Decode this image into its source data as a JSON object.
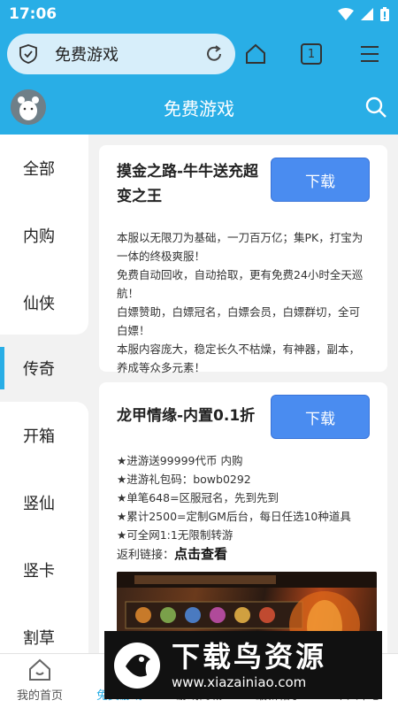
{
  "status": {
    "time": "17:06"
  },
  "browser": {
    "url_text": "免费游戏",
    "tab_count": "1"
  },
  "header": {
    "title": "免费游戏"
  },
  "sidebar": {
    "items": [
      {
        "label": "全部"
      },
      {
        "label": "内购"
      },
      {
        "label": "仙侠"
      },
      {
        "label": "传奇"
      },
      {
        "label": "开箱"
      },
      {
        "label": "竖仙"
      },
      {
        "label": "竖卡"
      },
      {
        "label": "割草"
      }
    ],
    "active_index": 3
  },
  "cards": [
    {
      "title": "摸金之路-牛牛送充超变之王",
      "download_label": "下载",
      "lines": [
        "本服以无限刀为基础，一刀百万亿；集PK，打宝为一体的终极爽服！",
        "免费自动回收，自动拾取，更有免费24小时全天巡航！",
        "白嫖赞助，白嫖冠名，白嫖会员，白嫖群切，全可白嫖！",
        "本服内容庞大，稳定长久不枯燥，有神器，副本，养成等众多元素！"
      ]
    },
    {
      "title": "龙甲情缘-内置0.1折",
      "download_label": "下载",
      "lines": [
        "★进游送99999代币 内购",
        "★进游礼包码：bowb0292",
        "★单笔648=区服冠名，先到先到",
        "★累计2500=定制GM后台，每日任选10种道具",
        "★可全网1:1无限制转游"
      ],
      "link_label": "返利链接：",
      "link_text": "点击查看"
    }
  ],
  "bottom_nav": {
    "items": [
      {
        "label": "我的首页"
      },
      {
        "label": "免费游戏"
      },
      {
        "label": "游戏商城"
      },
      {
        "label": "最新帖子"
      },
      {
        "label": "个人中心"
      }
    ],
    "active_index": 1
  },
  "watermark": {
    "big": "下载鸟资源",
    "small": "www.xiazainiao.com"
  },
  "colors": {
    "primary": "#29aee6",
    "button": "#4a8cf0"
  }
}
